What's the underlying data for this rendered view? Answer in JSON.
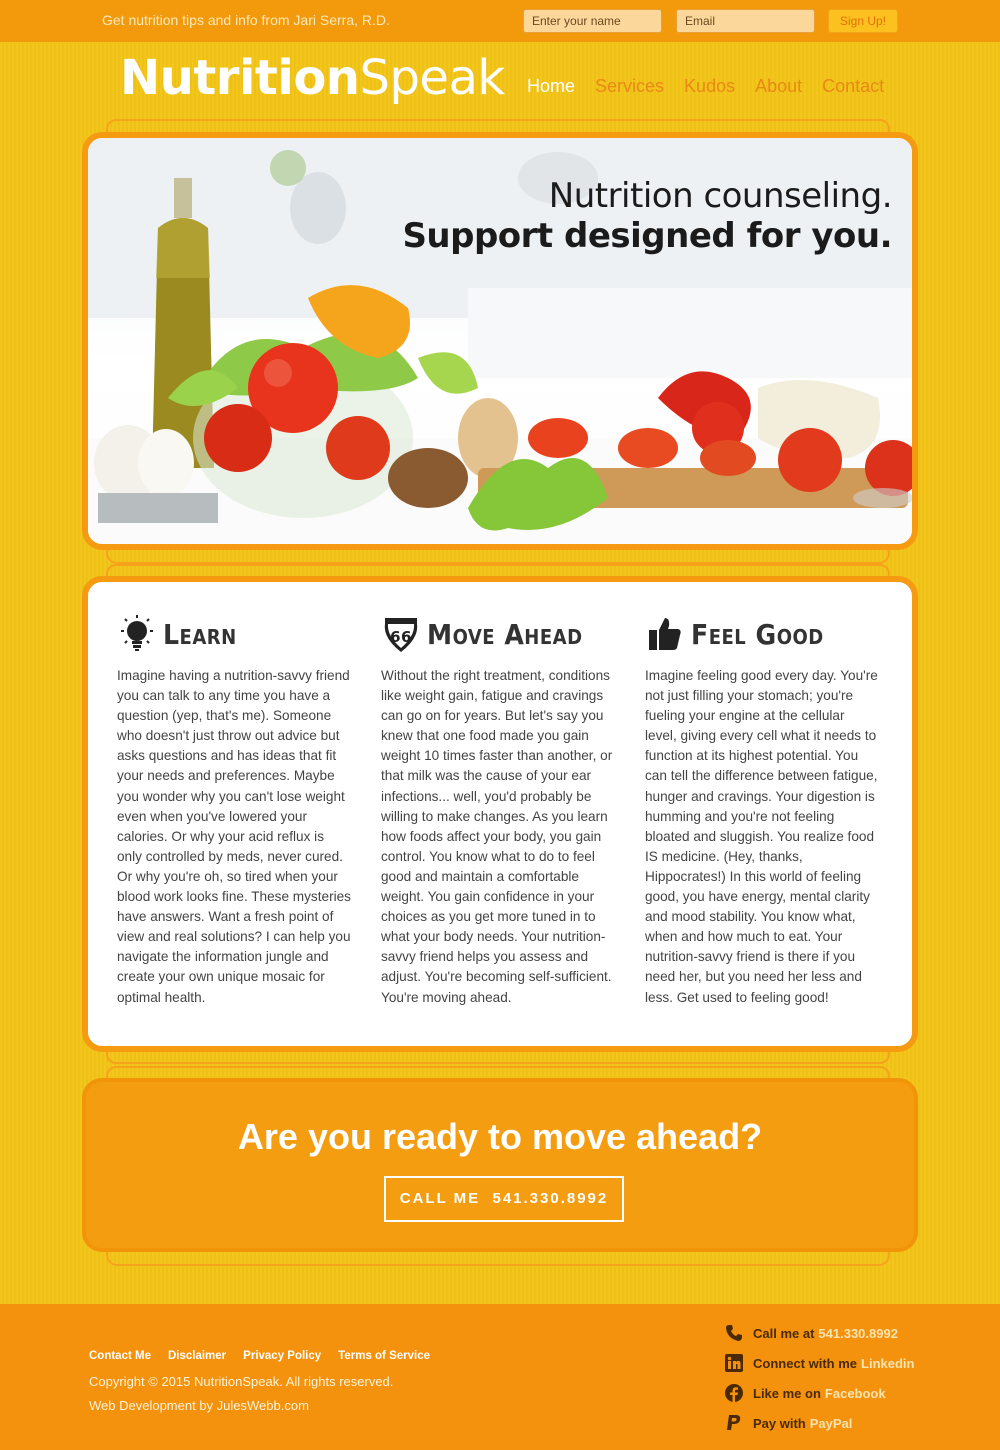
{
  "topbar": {
    "tagline": "Get nutrition tips and info from Jari Serra, R.D.",
    "name_placeholder": "Enter your name",
    "email_placeholder": "Email",
    "signup_label": "Sign Up!"
  },
  "header": {
    "logo_part1": "Nutrition",
    "logo_part2": "Speak",
    "nav": [
      {
        "label": "Home",
        "active": true
      },
      {
        "label": "Services",
        "active": false
      },
      {
        "label": "Kudos",
        "active": false
      },
      {
        "label": "About",
        "active": false
      },
      {
        "label": "Contact",
        "active": false
      }
    ]
  },
  "hero": {
    "line1": "Nutrition counseling.",
    "line2": "Support designed for you."
  },
  "features": [
    {
      "title": "Learn",
      "icon": "lightbulb-icon",
      "text": "Imagine having a nutrition-savvy friend you can talk to any time you have a question (yep, that's me). Someone who doesn't just throw out advice but asks questions and has ideas that fit your needs and preferences. Maybe you wonder why you can't lose weight even when you've lowered your calories. Or why your acid reflux is only controlled by meds, never cured. Or why you're oh, so tired when your blood work looks fine. These mysteries have answers. Want a fresh point of view and real solutions? I can help you navigate the information jungle and create your own unique mosaic for optimal health."
    },
    {
      "title": "Move Ahead",
      "icon": "route-66-icon",
      "badge": "66",
      "text": "Without the right treatment, conditions like weight gain, fatigue and cravings can go on for years. But let's say you knew that one food made you gain weight 10 times faster than another, or that milk was the cause of your ear infections... well, you'd probably be willing to make changes. As you learn how foods affect your body, you gain control. You know what to do to feel good and maintain a comfortable weight. You gain confidence in your choices as you get more tuned in to what your body needs. Your nutrition-savvy friend helps you assess and adjust. You're becoming self-sufficient. You're moving ahead."
    },
    {
      "title": "Feel Good",
      "icon": "thumbs-up-icon",
      "text": "Imagine feeling good every day. You're not just filling your stomach; you're fueling your engine at the cellular level, giving every cell what it needs to function at its highest potential. You can tell the difference between fatigue, hunger and cravings. Your digestion is humming and you're not feeling bloated and sluggish. You realize food IS medicine. (Hey, thanks, Hippocrates!) In this world of feeling good, you have energy, mental clarity and mood stability. You know what, when and how much to eat. Your nutrition-savvy friend is there if you need her, but you need her less and less. Get used to feeling good!"
    }
  ],
  "cta": {
    "heading": "Are you ready to move ahead?",
    "button_prefix": "CALL ME",
    "button_phone": "541.330.8992"
  },
  "footer": {
    "links": [
      "Contact Me",
      "Disclaimer",
      "Privacy Policy",
      "Terms of Service"
    ],
    "copyright": "Copyright © 2015 NutritionSpeak. All rights reserved.",
    "dev": "Web Development by JulesWebb.com",
    "contacts": [
      {
        "icon": "phone-icon",
        "prefix": "Call me at",
        "link": "541.330.8992"
      },
      {
        "icon": "linkedin-icon",
        "prefix": "Connect with me",
        "link": "Linkedin"
      },
      {
        "icon": "facebook-icon",
        "prefix": "Like me on",
        "link": "Facebook"
      },
      {
        "icon": "paypal-icon",
        "prefix": "Pay with",
        "link": "PayPal"
      }
    ]
  },
  "colors": {
    "background": "#f3c417",
    "topbar": "#f39a0c",
    "accent_orange": "#f59d10",
    "nav_inactive": "#e98816",
    "text_dark": "#333333"
  }
}
